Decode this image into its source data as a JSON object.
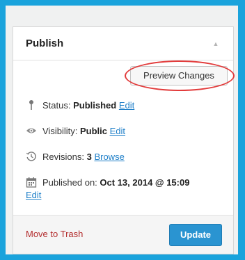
{
  "publish_box": {
    "title": "Publish",
    "toggle_icon": "triangle-up",
    "preview_button": "Preview Changes",
    "status": {
      "label": "Status:",
      "value": "Published",
      "action": "Edit",
      "icon": "pin-icon"
    },
    "visibility": {
      "label": "Visibility:",
      "value": "Public",
      "action": "Edit",
      "icon": "eye-icon"
    },
    "revisions": {
      "label": "Revisions:",
      "value": "3",
      "action": "Browse",
      "icon": "history-icon"
    },
    "published_on": {
      "label": "Published on:",
      "value": "Oct 13, 2014 @ 15:09",
      "action": "Edit",
      "icon": "calendar-icon"
    },
    "trash_link": "Move to Trash",
    "update_button": "Update"
  },
  "colors": {
    "background": "#1aa3dc",
    "panel": "#f0f1f1",
    "link": "#1e7fc8",
    "trash": "#b32d2e",
    "primary_button": "#2a94d1",
    "highlight_circle": "#e23b3b"
  }
}
